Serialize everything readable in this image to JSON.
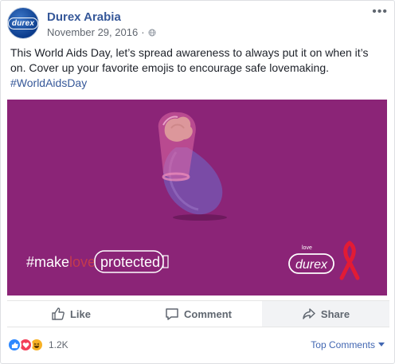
{
  "post": {
    "page_name": "Durex Arabia",
    "date": "November 29, 2016",
    "avatar_text": "durex",
    "text": "This World Aids Day, let’s spread awareness to always put it on when it’s on. Cover up your favorite emojis to encourage safe lovemaking.",
    "hashtag": "#WorldAidsDay"
  },
  "media": {
    "background_color": "#8b2477",
    "tagline_make": "#make",
    "tagline_love": "love",
    "tagline_protected": "protected",
    "brand_small": "love",
    "brand": "durex"
  },
  "actions": {
    "like": "Like",
    "comment": "Comment",
    "share": "Share"
  },
  "footer": {
    "reaction_count": "1.2K",
    "top_comments": "Top Comments"
  },
  "colors": {
    "link": "#365899",
    "accent": "#4267b2",
    "ribbon": "#e21b35"
  }
}
